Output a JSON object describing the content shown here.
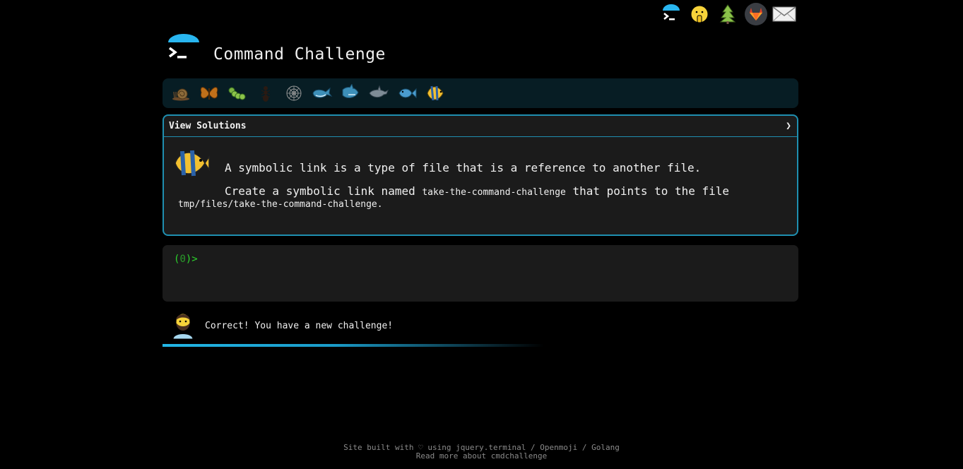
{
  "header": {
    "title": "Command Challenge"
  },
  "topbar": {
    "icons": [
      "terminal-logo-icon",
      "shushing-face-icon",
      "tree-icon",
      "gitlab-icon",
      "envelope-icon"
    ]
  },
  "levels": [
    "snail-icon",
    "butterfly-icon",
    "caterpillar-icon",
    "ant-icon",
    "spider-web-icon",
    "whale-icon",
    "shark-icon",
    "dolphin-icon",
    "fish-icon",
    "tropical-fish-icon"
  ],
  "challenge": {
    "toggle_label": "View Solutions",
    "toggle_arrow": "❯",
    "line1": "A symbolic link is a type of file that is a reference to another file.",
    "line2_prefix": "Create a symbolic link named ",
    "line2_code": "take-the-command-challenge",
    "line2_suffix": " that points to the file",
    "line3_code": "tmp/files/take-the-command-challenge",
    "line3_suffix": "."
  },
  "terminal": {
    "prompt_open": "(",
    "prompt_count": "0",
    "prompt_close": ")>"
  },
  "feedback": {
    "message": "Correct! You have a new challenge!"
  },
  "progress": {
    "fraction": 0.6
  },
  "footer": {
    "line1": "Site built with ♡ using jquery.terminal / Openmoji / Golang",
    "line2": "Read more about cmdchallenge"
  },
  "colors": {
    "accent": "#1f8fb0",
    "prompt_green": "#2cd52c",
    "level_bar": "#071d24"
  }
}
